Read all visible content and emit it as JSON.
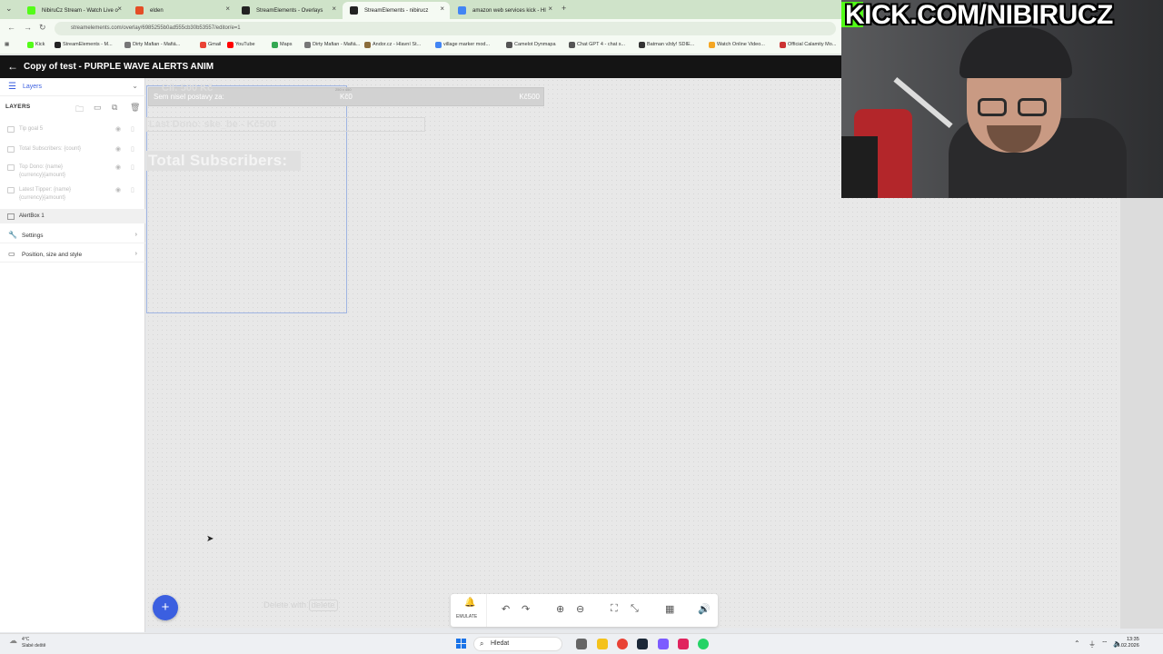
{
  "browser": {
    "tabs": [
      {
        "title": "NibiruCz Stream - Watch Live o",
        "color": "#53fc18",
        "active": false
      },
      {
        "title": "elden",
        "color": "#e44d26",
        "active": false
      },
      {
        "title": "StreamElements - Overlays",
        "color": "#222222",
        "active": false
      },
      {
        "title": "StreamElements - nibirucz",
        "color": "#222222",
        "active": true
      },
      {
        "title": "amazon web services kick - Hl",
        "color": "#4285f4",
        "active": false
      }
    ],
    "new_tab": "+",
    "url": "streamelements.com/overlay/6985255b0ad555cb30b53557/editor/e=1",
    "bookmarks": [
      {
        "label": "Kick",
        "color": "#53fc18"
      },
      {
        "label": "StreamElements - M...",
        "color": "#222222"
      },
      {
        "label": "Dirty Mafian - Mafiá...",
        "color": "#777777"
      },
      {
        "label": "Gmail",
        "color": "#ea4335"
      },
      {
        "label": "YouTube",
        "color": "#ff0000"
      },
      {
        "label": "Maps",
        "color": "#34a853"
      },
      {
        "label": "Dirty Mafian - Mafiá...",
        "color": "#777777"
      },
      {
        "label": "Andor.cz - Hlavní St...",
        "color": "#8a6d3b"
      },
      {
        "label": "village marker mod...",
        "color": "#4285f4"
      },
      {
        "label": "Camelot Dynmapa",
        "color": "#555555"
      },
      {
        "label": "Chat GPT 4 - chat s...",
        "color": "#555555"
      },
      {
        "label": "Batman vždy! SDIE...",
        "color": "#333333"
      },
      {
        "label": "Watch Online Video...",
        "color": "#f5a623"
      },
      {
        "label": "Official Calamity Mo...",
        "color": "#cc3333"
      }
    ]
  },
  "header": {
    "title": "Copy of test - PURPLE WAVE ALERTS ANIM"
  },
  "sidebar": {
    "panel_label": "Layers",
    "layers_caption": "LAYERS",
    "layers": [
      {
        "label": "Tip goal 5"
      },
      {
        "label": "Total Subscribers: {count}"
      },
      {
        "label": "Top Dono: {name}\n{currency}{amount}"
      },
      {
        "label": "Latest Tipper: {name}\n{currency}{amount}"
      }
    ],
    "selected_layer": "AlertBox 1",
    "sections": [
      {
        "label": "Settings",
        "icon": "wrench-icon"
      },
      {
        "label": "Position, size and style",
        "icon": "frame-icon"
      }
    ]
  },
  "canvas": {
    "goal": {
      "title": "Sem nisel postavy za:",
      "ghost_text": "Cíl: 500 Kč",
      "start": "Kč0",
      "target": "Kč500",
      "dimension_label": "250 x 450"
    },
    "last_dono": "Last Dono: ske_be - Kč500",
    "total_subs": "Total Subscribers:",
    "delete_hint_prefix": "Delete with",
    "delete_hint_key": "delete",
    "add_button": "+",
    "toolbar": {
      "emulate_label": "EMULATE"
    }
  },
  "webcam": {
    "banner_text": "KICK.COM/NIBIRUCZ",
    "accent": "#53fc18"
  },
  "taskbar": {
    "weather_temp": "4°C",
    "weather_desc": "Slabé deště",
    "search_placeholder": "Hledat",
    "time": "13:35",
    "date": "16.02.2026"
  },
  "colors": {
    "accent": "#3b5fe0",
    "header_bg": "#141414"
  }
}
